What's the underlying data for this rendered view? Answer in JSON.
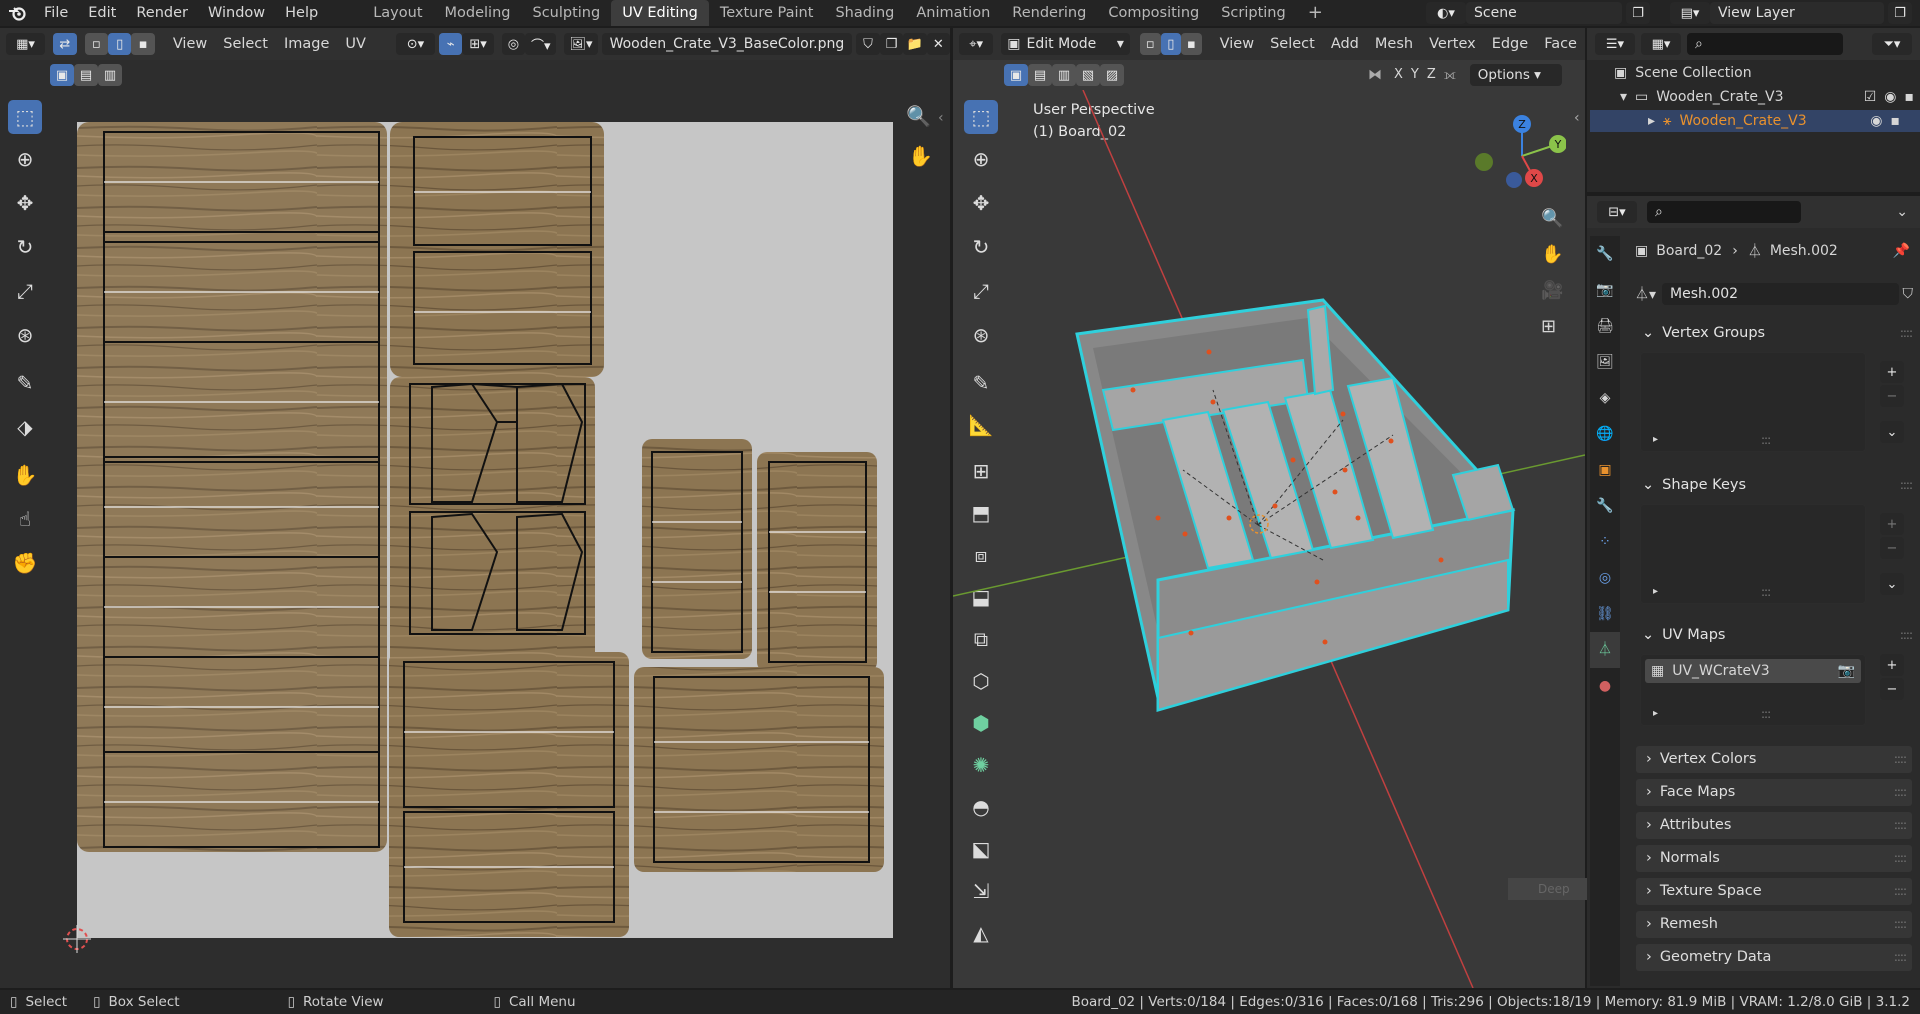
{
  "menu": {
    "file": "File",
    "edit": "Edit",
    "render": "Render",
    "window": "Window",
    "help": "Help"
  },
  "workspaces": {
    "tabs": [
      "Layout",
      "Modeling",
      "Sculpting",
      "UV Editing",
      "Texture Paint",
      "Shading",
      "Animation",
      "Rendering",
      "Compositing",
      "Scripting"
    ],
    "active_index": 3,
    "add_icon": "plus-icon"
  },
  "scene": {
    "name": "Scene"
  },
  "view_layer": {
    "name": "View Layer"
  },
  "uv_editor": {
    "header": {
      "view": "View",
      "select": "Select",
      "image": "Image",
      "uv": "UV",
      "image_name": "Wooden_Crate_V3_BaseColor.png"
    }
  },
  "viewport": {
    "header": {
      "mode": "Edit Mode",
      "view": "View",
      "select": "Select",
      "add": "Add",
      "mesh": "Mesh",
      "vertex": "Vertex",
      "edge": "Edge",
      "face": "Face",
      "options": "Options",
      "x": "X",
      "y": "Y",
      "z": "Z"
    },
    "overlay": {
      "perspective": "User Perspective",
      "object": "(1) Board_02"
    },
    "gizmo": {
      "z": "Z",
      "y": "Y",
      "x": "X"
    },
    "faded_label": "Deep"
  },
  "outliner": {
    "search_placeholder": "",
    "scene_collection": "Scene Collection",
    "collection": "Wooden_Crate_V3",
    "object": "Wooden_Crate_V3"
  },
  "properties": {
    "breadcrumb_object": "Board_02",
    "breadcrumb_mesh": "Mesh.002",
    "mesh_name": "Mesh.002",
    "panels": {
      "vertex_groups": "Vertex Groups",
      "shape_keys": "Shape Keys",
      "uv_maps": "UV Maps",
      "uv_map_item": "UV_WCrateV3",
      "vertex_colors": "Vertex Colors",
      "face_maps": "Face Maps",
      "attributes": "Attributes",
      "normals": "Normals",
      "texture_space": "Texture Space",
      "remesh": "Remesh",
      "geometry_data": "Geometry Data"
    }
  },
  "statusbar": {
    "select": "Select",
    "box_select": "Box Select",
    "rotate_view": "Rotate View",
    "call_menu": "Call Menu",
    "stats": "Board_02 | Verts:0/184 | Edges:0/316 | Faces:0/168 | Tris:296 | Objects:18/19 | Memory: 81.9 MiB | VRAM: 1.2/8.0 GiB | 3.1.2"
  },
  "colors": {
    "accent_blue": "#4772b3",
    "selection_cyan": "#2fd0dc",
    "orange_highlight": "#e8912e",
    "wood": "#8c7552",
    "uv_background": "#c6c6c6"
  }
}
